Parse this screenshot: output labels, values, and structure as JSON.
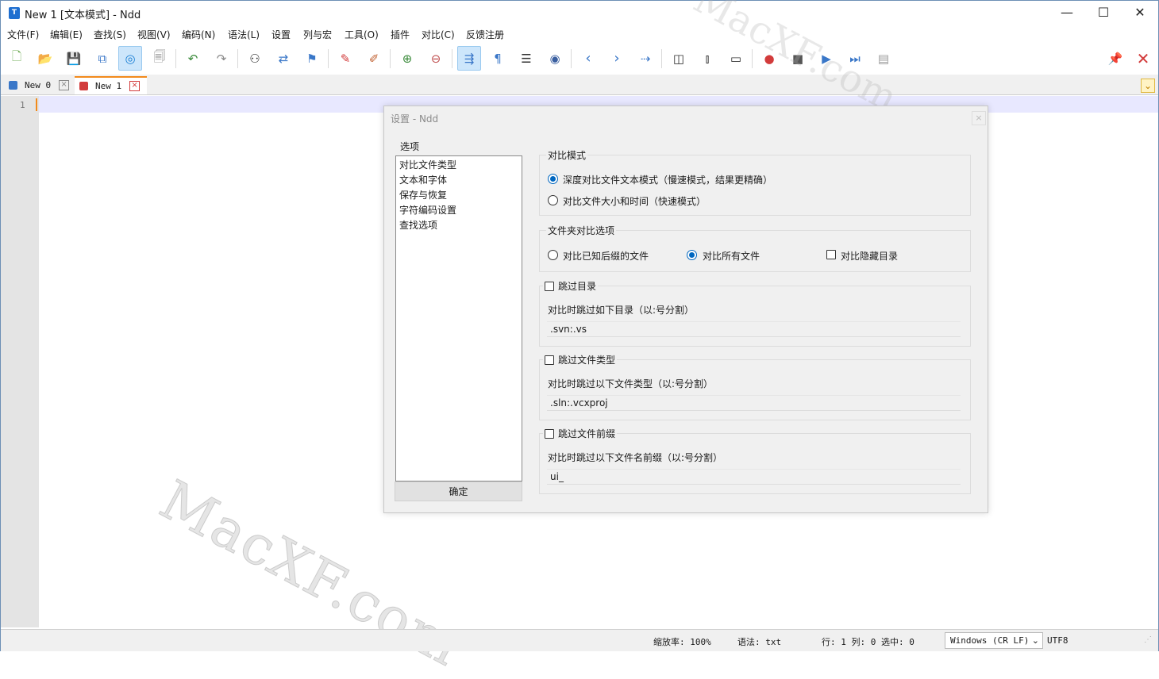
{
  "window": {
    "title": "New 1 [文本模式] - Ndd",
    "app_icon_letter": "T",
    "controls": {
      "minimize": "—",
      "maximize": "☐",
      "close": "✕"
    }
  },
  "menu": [
    "文件(F)",
    "编辑(E)",
    "查找(S)",
    "视图(V)",
    "编码(N)",
    "语法(L)",
    "设置",
    "列与宏",
    "工具(O)",
    "插件",
    "对比(C)",
    "反馈注册"
  ],
  "toolbar": {
    "icons": [
      "new-file-icon",
      "open-file-icon",
      "save-icon",
      "save-all-icon",
      "compare-mode-icon",
      "close-file-icon",
      "undo-icon",
      "redo-icon",
      "find-icon",
      "replace-icon",
      "bookmark-icon",
      "mark-icon",
      "clear-mark-icon",
      "zoom-in-icon",
      "zoom-out-icon",
      "word-wrap-icon",
      "show-symbols-icon",
      "indent-guide-icon",
      "record-icon",
      "prev-icon",
      "next-icon",
      "goto-icon",
      "split-icon",
      "vsplit-icon",
      "monitor-icon",
      "macro-record-icon",
      "macro-stop-icon",
      "macro-play-icon",
      "macro-run-icon",
      "macro-save-icon",
      "pin-icon",
      "close-red-icon"
    ],
    "glyphs": {
      "new": "🗋",
      "open": "📂",
      "save": "💾",
      "saveall": "⧉",
      "compare": "◎",
      "closef": "🗐",
      "undo": "↶",
      "redo": "↷",
      "find": "⚇",
      "replace": "⇄",
      "bookmark": "⚑",
      "mark": "✎",
      "clearmark": "✐",
      "zoomin": "⊕",
      "zoomout": "⊖",
      "wrap": "⇶",
      "pilcrow": "¶",
      "indent": "☰",
      "rec": "◉",
      "prev": "‹",
      "next": "›",
      "goto": "⇢",
      "split": "◫",
      "vsplit": "⫾",
      "monitor": "▭",
      "mrec": "●",
      "mstop": "■",
      "mplay": "▶",
      "mrun": "⏭",
      "msave": "▤",
      "pin": "📌",
      "close": "✕"
    }
  },
  "tabs": [
    {
      "label": "New 0",
      "active": false,
      "icon_color": "#3a77c8"
    },
    {
      "label": "New 1",
      "active": true,
      "icon_color": "#d23b3b"
    }
  ],
  "editor": {
    "line_number": "1"
  },
  "watermark": {
    "text": "MacXF.com"
  },
  "dialog": {
    "title": "设置 - Ndd",
    "close_label": "×",
    "options_group_label": "选项",
    "options": [
      "对比文件类型",
      "文本和字体",
      "保存与恢复",
      "字符编码设置",
      "查找选项"
    ],
    "ok_button": "确定",
    "compare_mode": {
      "label": "对比模式",
      "options": [
        {
          "label": "深度对比文件文本模式（慢速模式，结果更精确）",
          "selected": true
        },
        {
          "label": "对比文件大小和时间（快速模式）",
          "selected": false
        }
      ]
    },
    "folder_compare": {
      "label": "文件夹对比选项",
      "known_ext": {
        "label": "对比已知后缀的文件",
        "selected": false
      },
      "all_files": {
        "label": "对比所有文件",
        "selected": true
      },
      "hidden_dirs": {
        "label": "对比隐藏目录",
        "checked": false
      }
    },
    "skip_dirs": {
      "label": "跳过目录",
      "checked": false,
      "description": "对比时跳过如下目录（以:号分割）",
      "value": ".svn:.vs"
    },
    "skip_types": {
      "label": "跳过文件类型",
      "checked": false,
      "description": "对比时跳过以下文件类型（以:号分割）",
      "value": ".sln:.vcxproj"
    },
    "skip_prefix": {
      "label": "跳过文件前缀",
      "checked": false,
      "description": "对比时跳过以下文件名前缀（以:号分割）",
      "value": "ui_"
    }
  },
  "status": {
    "zoom": "缩放率: 100%",
    "syntax": "语法: txt",
    "position": "行: 1 列: 0 选中: 0",
    "eol": "Windows (CR LF)",
    "encoding": "UTF8"
  },
  "colors": {
    "accent": "#0067c0",
    "tab_active_border": "#f28a1c",
    "close_red": "#d23b3b"
  }
}
